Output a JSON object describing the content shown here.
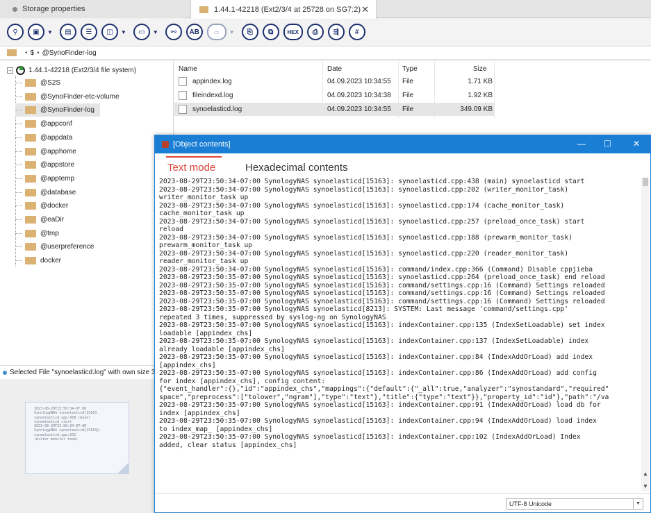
{
  "tabs": [
    {
      "label": "Storage properties"
    },
    {
      "label": "1.44.1-42218 (Ext2/3/4 at 25728 on SG7:2)"
    }
  ],
  "toolbar": {
    "buttons": [
      {
        "icon": "search-icon",
        "glyph": "⚲"
      },
      {
        "icon": "save-icon",
        "glyph": "▣"
      },
      {
        "icon": "save-as-icon",
        "glyph": "▤"
      },
      {
        "icon": "list-icon",
        "glyph": "☰"
      },
      {
        "icon": "view-icon",
        "glyph": "◫"
      },
      {
        "icon": "panel-icon",
        "glyph": "▭"
      },
      {
        "icon": "find-icon",
        "glyph": "⚯"
      },
      {
        "icon": "match-case-icon",
        "glyph": "AB"
      },
      {
        "icon": "image-icon",
        "glyph": "▭"
      },
      {
        "icon": "file-icon",
        "glyph": "⎘"
      },
      {
        "icon": "copy-icon",
        "glyph": "⧉"
      },
      {
        "icon": "hex-icon",
        "glyph": "HEX"
      },
      {
        "icon": "print-icon",
        "glyph": "⎙"
      },
      {
        "icon": "export-icon",
        "glyph": "⇶"
      },
      {
        "icon": "number-icon",
        "glyph": "#"
      }
    ]
  },
  "breadcrumb": {
    "parts": [
      "$",
      "@SynoFinder-log"
    ]
  },
  "tree": {
    "root": "1.44.1-42218 (Ext2/3/4 file system)",
    "items": [
      "@S2S",
      "@SynoFinder-etc-volume",
      "@SynoFinder-log",
      "@appconf",
      "@appdata",
      "@apphome",
      "@appstore",
      "@apptemp",
      "@database",
      "@docker",
      "@eaDir",
      "@tmp",
      "@userpreference",
      "docker"
    ],
    "selected": "@SynoFinder-log"
  },
  "filelist": {
    "headers": {
      "name": "Name",
      "date": "Date",
      "type": "Type",
      "size": "Size"
    },
    "rows": [
      {
        "name": "appindex.log",
        "date": "04.09.2023 10:34:55",
        "type": "File",
        "size": "1.71 KB"
      },
      {
        "name": "fileindexd.log",
        "date": "04.09.2023 10:34:38",
        "type": "File",
        "size": "1.92 KB"
      },
      {
        "name": "synoelasticd.log",
        "date": "04.09.2023 10:34:55",
        "type": "File",
        "size": "349.09 KB"
      }
    ]
  },
  "status": {
    "text": "Selected File \"synoelasticd.log\" with own size 35"
  },
  "preview": {
    "lines": [
      "2023-08-29T23:50:34-07:00",
      "SynologyNAS synoelasticd[15163",
      "synoelasticd.cpp:438 (main)",
      "synoelasticd start",
      "2023-08-29T23:50:34-07:00",
      "SynologyNAS synoelasticd[15163]:",
      "synoelasticd.cpp:202",
      "(writer monitor task)"
    ]
  },
  "object_window": {
    "title": "[Object contents]",
    "tab_text": "Text mode",
    "tab_hex": "Hexadecimal contents",
    "encoding": "UTF-8 Unicode",
    "lines": [
      "2023-08-29T23:50:34-07:00 SynologyNAS synoelasticd[15163]: synoelasticd.cpp:438 (main) synoelasticd start",
      "2023-08-29T23:50:34-07:00 SynologyNAS synoelasticd[15163]: synoelasticd.cpp:202 (writer_monitor_task)",
      "writer_monitor_task up",
      "2023-08-29T23:50:34-07:00 SynologyNAS synoelasticd[15163]: synoelasticd.cpp:174 (cache_monitor_task)",
      "cache_monitor_task up",
      "2023-08-29T23:50:34-07:00 SynologyNAS synoelasticd[15163]: synoelasticd.cpp:257 (preload_once_task) start",
      "reload",
      "2023-08-29T23:50:34-07:00 SynologyNAS synoelasticd[15163]: synoelasticd.cpp:188 (prewarm_monitor_task)",
      "prewarm_monitor_task up",
      "2023-08-29T23:50:34-07:00 SynologyNAS synoelasticd[15163]: synoelasticd.cpp:220 (reader_monitor_task)",
      "reader_monitor_task up",
      "2023-08-29T23:50:34-07:00 SynologyNAS synoelasticd[15163]: command/index.cpp:366 (Command) Disable cppjieba",
      "2023-08-29T23:50:35-07:00 SynologyNAS synoelasticd[15163]: synoelasticd.cpp:264 (preload_once_task) end reload",
      "2023-08-29T23:50:35-07:00 SynologyNAS synoelasticd[15163]: command/settings.cpp:16 (Command) Settings reloaded",
      "2023-08-29T23:50:35-07:00 SynologyNAS synoelasticd[15163]: command/settings.cpp:16 (Command) Settings reloaded",
      "2023-08-29T23:50:35-07:00 SynologyNAS synoelasticd[15163]: command/settings.cpp:16 (Command) Settings reloaded",
      "2023-08-29T23:50:35-07:00 SynologyNAS synoelasticd[8213]: SYSTEM:    Last message 'command/settings.cpp'",
      "repeated 3 times, suppressed by syslog-ng on SynologyNAS",
      "2023-08-29T23:50:35-07:00 SynologyNAS synoelasticd[15163]: indexContainer.cpp:135 (IndexSetLoadable) set index",
      "loadable [appindex_chs]",
      "2023-08-29T23:50:35-07:00 SynologyNAS synoelasticd[15163]: indexContainer.cpp:137 (IndexSetLoadable) index",
      "already loadable [appindex_chs]",
      "2023-08-29T23:50:35-07:00 SynologyNAS synoelasticd[15163]: indexContainer.cpp:84 (IndexAddOrLoad) add index",
      "[appindex_chs]",
      "2023-08-29T23:50:35-07:00 SynologyNAS synoelasticd[15163]: indexContainer.cpp:86 (IndexAddOrLoad) add config",
      "for index [appindex_chs], config content:",
      "{\"event_handler\":{},\"id\":\"appindex_chs\",\"mappings\":{\"default\":{\"_all\":true,\"analyzer\":\"synostandard\",\"required\"",
      "space\",\"preprocess\":[\"tolower\",\"ngram\"],\"type\":\"text\"},\"title\":{\"type\":\"text\"}},\"property_id\":\"id\"},\"path\":\"/va",
      "2023-08-29T23:50:35-07:00 SynologyNAS synoelasticd[15163]: indexContainer.cpp:91 (IndexAddOrLoad) load db for",
      "index [appindex_chs]",
      "2023-08-29T23:50:35-07:00 SynologyNAS synoelasticd[15163]: indexContainer.cpp:94 (IndexAddOrLoad) load index",
      "to index_map_ [appindex_chs]",
      "2023-08-29T23:50:35-07:00 SynologyNAS synoelasticd[15163]: indexContainer.cpp:102 (IndexAddOrLoad) Index",
      "added, clear status [appindex_chs]"
    ]
  }
}
